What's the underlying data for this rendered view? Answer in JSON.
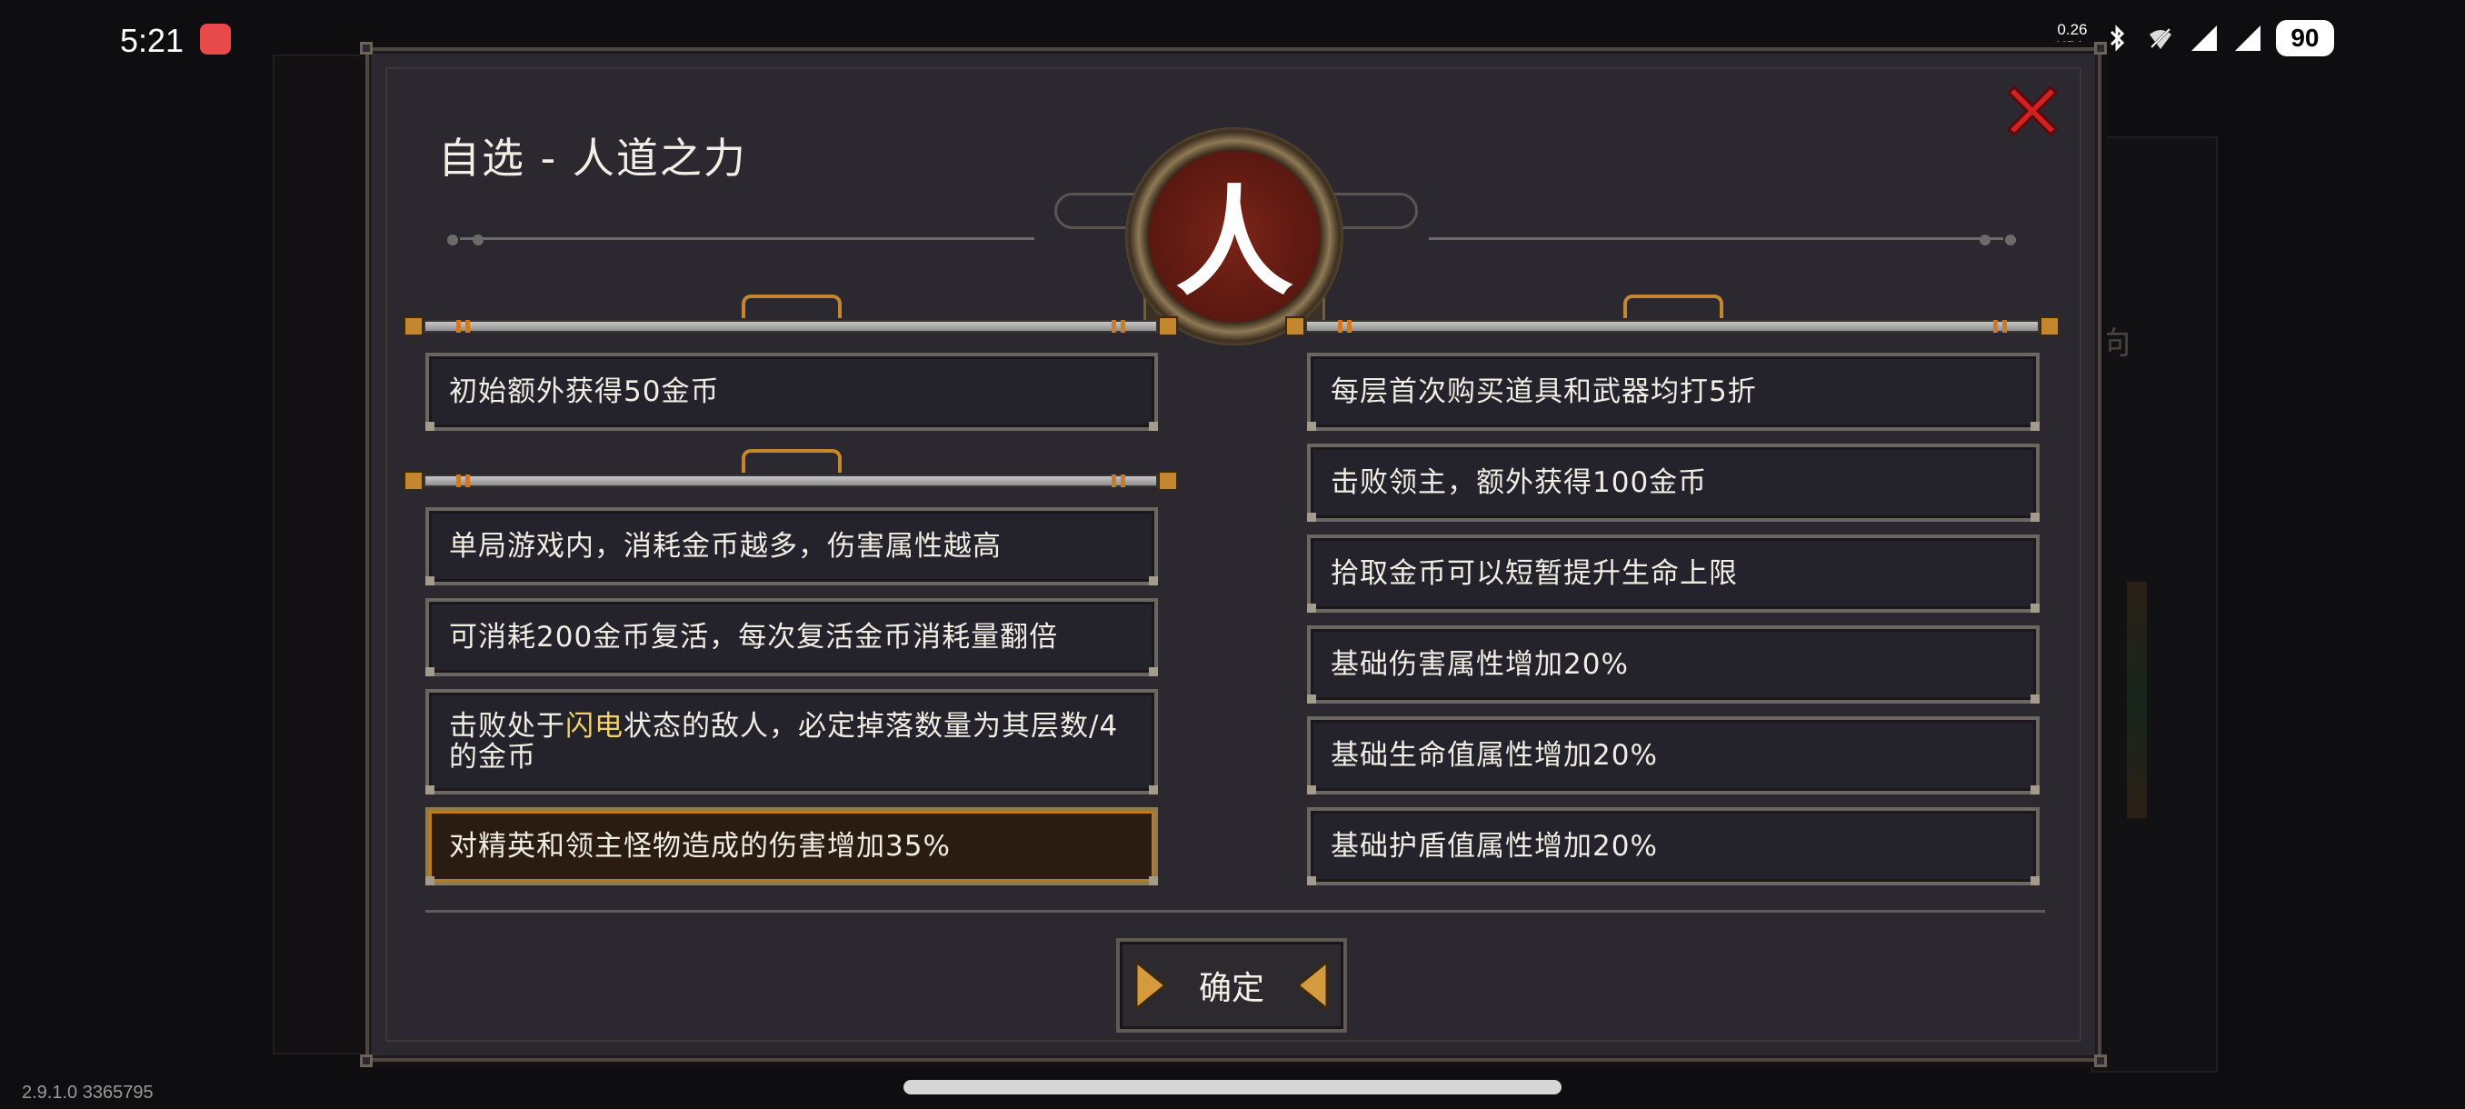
{
  "status_bar": {
    "time": "5:21",
    "net_speed_value": "0.26",
    "net_speed_unit": "KB/s",
    "battery": "90",
    "icons": [
      "bluetooth-icon",
      "wifi-off-icon",
      "signal-5g-icon",
      "signal-4g-icon"
    ]
  },
  "dialog": {
    "title": "自选 - 人道之力",
    "emblem_glyph": "人",
    "left_group_1": [
      {
        "text": "初始额外获得50金币"
      }
    ],
    "left_group_2": [
      {
        "text": "单局游戏内，消耗金币越多，伤害属性越高"
      },
      {
        "text": "可消耗200金币复活，每次复活金币消耗量翻倍"
      },
      {
        "text_before": "击败处于",
        "highlight": "闪电",
        "text_after": "状态的敌人，必定掉落数量为其层数/4的金币"
      },
      {
        "text": "对精英和领主怪物造成的伤害增加35%",
        "selected": true
      }
    ],
    "right_group": [
      {
        "text": "每层首次购买道具和武器均打5折"
      },
      {
        "text": "击败领主，额外获得100金币"
      },
      {
        "text": "拾取金币可以短暂提升生命上限"
      },
      {
        "text": "基础伤害属性增加20%"
      },
      {
        "text": "基础生命值属性增加20%"
      },
      {
        "text": "基础护盾值属性增加20%"
      }
    ],
    "confirm_label": "确定"
  },
  "background": {
    "side_char": "向"
  },
  "version": "2.9.1.0 3365795",
  "colors": {
    "panel": "#2b2830",
    "highlight_text": "#f2d36a",
    "selected_border": "#c07a1e",
    "close_red": "#d32020"
  }
}
